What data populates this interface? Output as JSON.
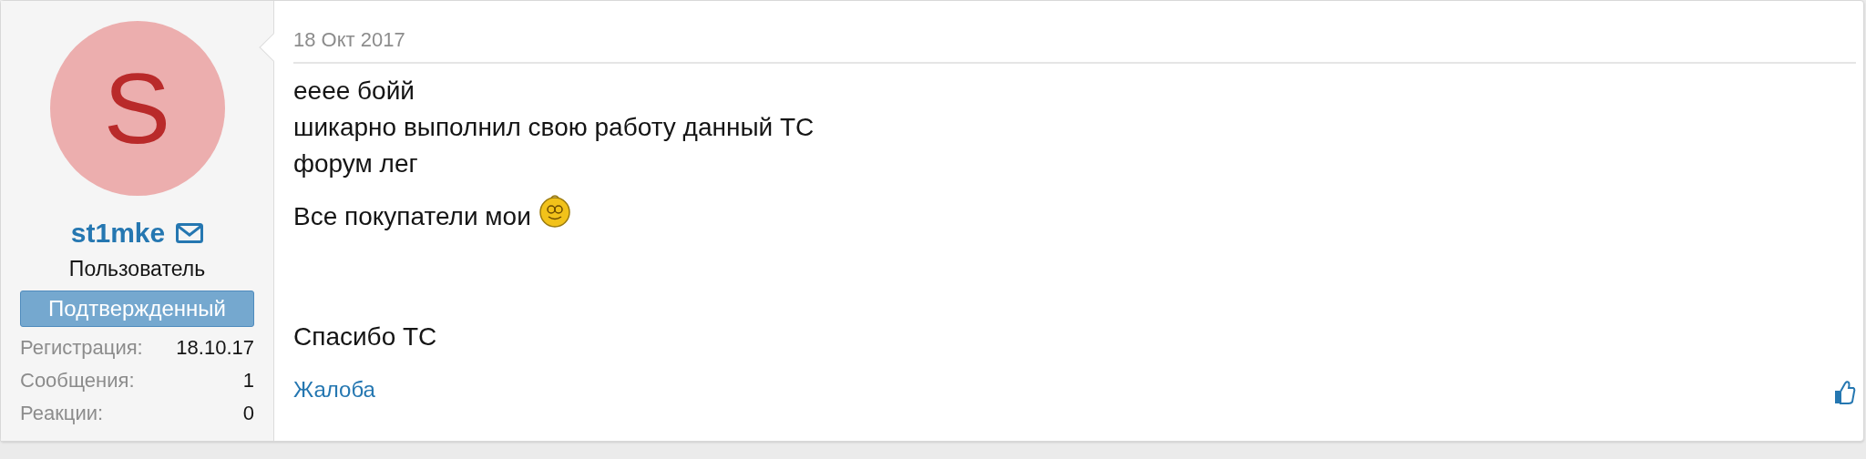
{
  "user": {
    "initial": "S",
    "name": "st1mke",
    "title": "Пользователь",
    "banner": "Подтвержденный",
    "stats": [
      {
        "label": "Регистрация:",
        "value": "18.10.17"
      },
      {
        "label": "Сообщения:",
        "value": "1"
      },
      {
        "label": "Реакции:",
        "value": "0"
      }
    ]
  },
  "post": {
    "date": "18 Окт 2017",
    "lines": [
      {
        "text": "eeee бойй",
        "smiley": false
      },
      {
        "text": "шикарно выполнил свою работу данный ТС",
        "smiley": false
      },
      {
        "text": "форум лег",
        "smiley": false
      },
      {
        "text": "Все покупатели мои",
        "smiley": true
      },
      {
        "text": "Спасибо ТС",
        "smiley": false
      }
    ],
    "report_link": "Жалоба"
  }
}
